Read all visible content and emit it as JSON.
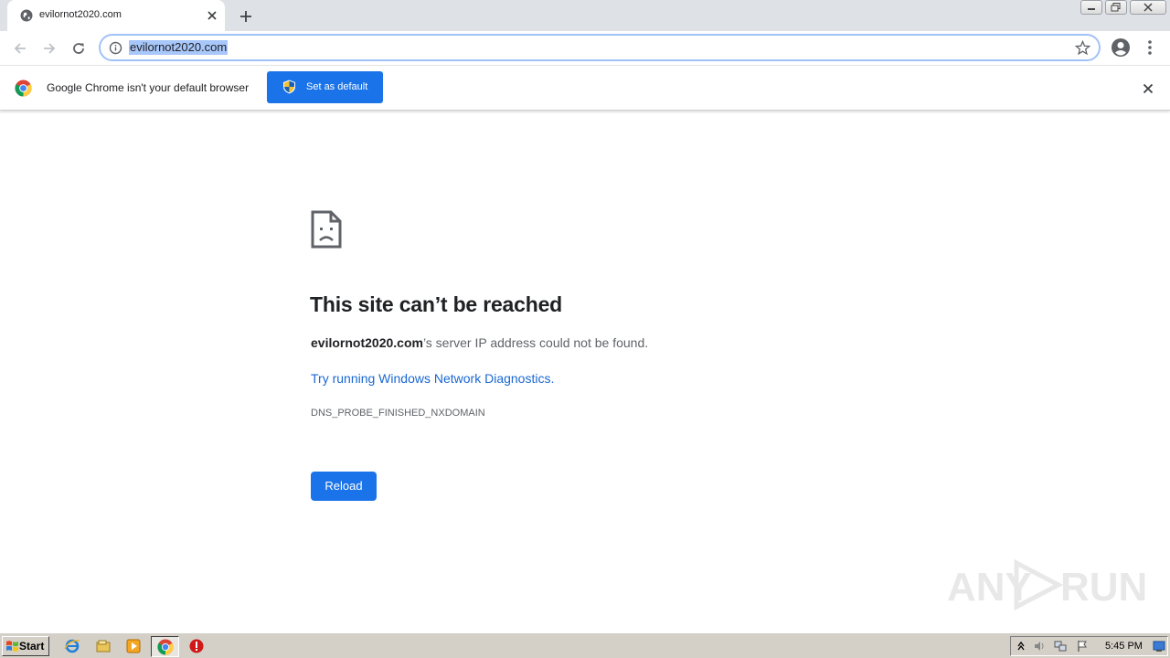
{
  "tab": {
    "title": "evilornot2020.com",
    "favicon": "globe-icon"
  },
  "toolbar": {
    "url": "evilornot2020.com"
  },
  "infobar": {
    "message": "Google Chrome isn't your default browser",
    "button_label": "Set as default"
  },
  "error_page": {
    "heading": "This site can’t be reached",
    "message_domain": "evilornot2020.com",
    "message_rest": "’s server IP address could not be found.",
    "link_text": "Try running Windows Network Diagnostics.",
    "error_code": "DNS_PROBE_FINISHED_NXDOMAIN",
    "reload_label": "Reload"
  },
  "watermark": {
    "left": "ANY",
    "right": "RUN"
  },
  "taskbar": {
    "start_label": "Start",
    "clock": "5:45 PM"
  },
  "colors": {
    "accent": "#1a73e8",
    "link": "#1967d2",
    "url_selection": "#a8c7fa",
    "tabstrip": "#dee1e6",
    "taskbar": "#d4d0c8"
  }
}
